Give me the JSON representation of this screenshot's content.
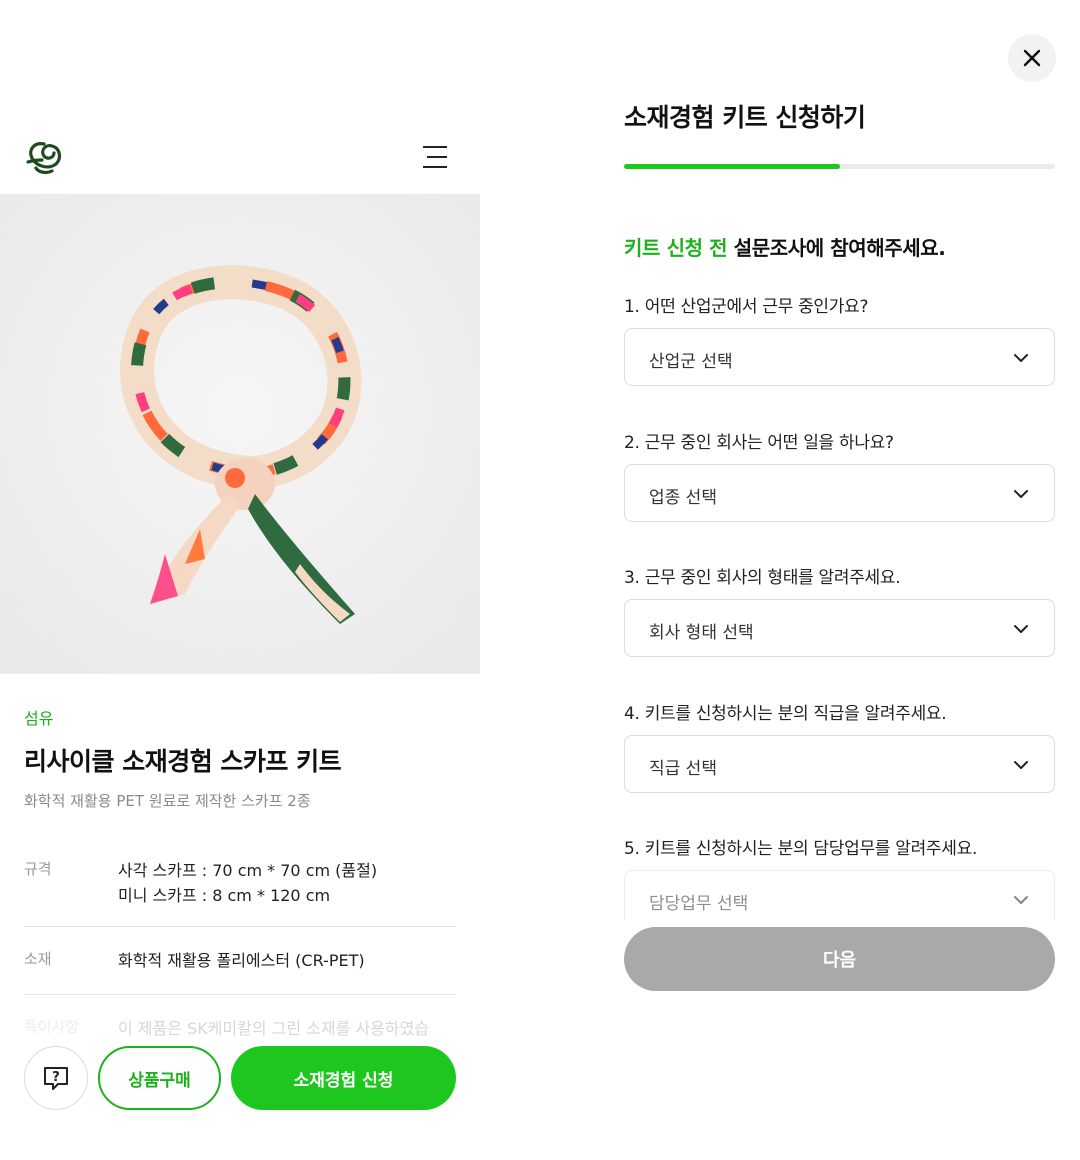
{
  "header": {
    "logo_icon": "sk-logo-icon",
    "menu_icon": "hamburger-menu-icon"
  },
  "product": {
    "category": "섬유",
    "title": "리사이클 소재경험 스카프 키트",
    "description": "화학적 재활용 PET 원료로 제작한 스카프 2종",
    "specs": [
      {
        "key": "규격",
        "values": [
          "사각 스카프 : 70 cm * 70 cm (품절)",
          "미니 스카프 : 8 cm * 120 cm"
        ]
      },
      {
        "key": "소재",
        "values": [
          "화학적 재활용 폴리에스터 (CR-PET)"
        ]
      },
      {
        "key": "특이사항",
        "values": [
          "이 제품은 SK케미칼의 그린 소재를 사용하였습"
        ]
      }
    ]
  },
  "actions": {
    "qa_icon": "question-chat-icon",
    "buy_label": "상품구매",
    "apply_label": "소재경험 신청"
  },
  "modal": {
    "close_icon": "close-icon",
    "title": "소재경험 키트 신청하기",
    "progress": 0.5,
    "intro_highlight": "키트 신청 전",
    "intro_rest": " 설문조사에 참여해주세요.",
    "questions": [
      {
        "label": "1. 어떤 산업군에서 근무 중인가요?",
        "placeholder": "산업군 선택"
      },
      {
        "label": "2. 근무 중인 회사는 어떤 일을 하나요?",
        "placeholder": "업종 선택"
      },
      {
        "label": "3. 근무 중인 회사의 형태를 알려주세요.",
        "placeholder": "회사 형태 선택"
      },
      {
        "label": "4. 키트를 신청하시는 분의 직급을 알려주세요.",
        "placeholder": "직급 선택"
      },
      {
        "label": "5. 키트를 신청하시는 분의 담당업무를 알려주세요.",
        "placeholder": "담당업무 선택"
      }
    ],
    "next_label": "다음"
  },
  "colors": {
    "accent": "#1ec71e",
    "accent_text": "#1bb21b",
    "disabled": "#a9a9a9"
  }
}
